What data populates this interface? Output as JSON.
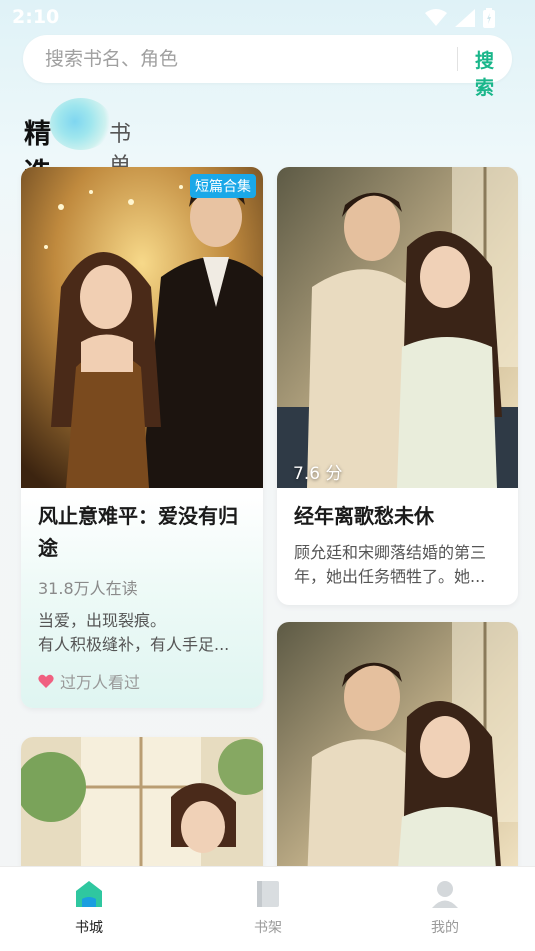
{
  "status_bar": {
    "time": "2:10"
  },
  "search": {
    "placeholder": "搜索书名、角色",
    "button_label": "搜索"
  },
  "tabs": [
    {
      "label": "精选",
      "active": true
    },
    {
      "label": "书单",
      "active": false
    }
  ],
  "cards": [
    {
      "badge": "短篇合集",
      "title_line1": "风止意难平：爱没有归",
      "title_line2": "途",
      "readers": "31.8万人在读",
      "desc_line1": "当爱，出现裂痕。",
      "desc_line2": "有人积极缝补，有人手足...",
      "viewed": "过万人看过"
    },
    {
      "score": "7.6 分",
      "title": "经年离歌愁未休",
      "desc_line1": "顾允廷和宋卿落结婚的第三",
      "desc_line2": "年，她出任务牺牲了。她..."
    }
  ],
  "bottom_nav": [
    {
      "label": "书城",
      "icon": "bookstore-icon",
      "active": true
    },
    {
      "label": "书架",
      "icon": "bookshelf-icon",
      "active": false
    },
    {
      "label": "我的",
      "icon": "profile-icon",
      "active": false
    }
  ],
  "colors": {
    "accent": "#19b68a",
    "badge": "#1aa8e8",
    "nav_active": "#222222",
    "nav_inactive": "#9a9a9a"
  }
}
